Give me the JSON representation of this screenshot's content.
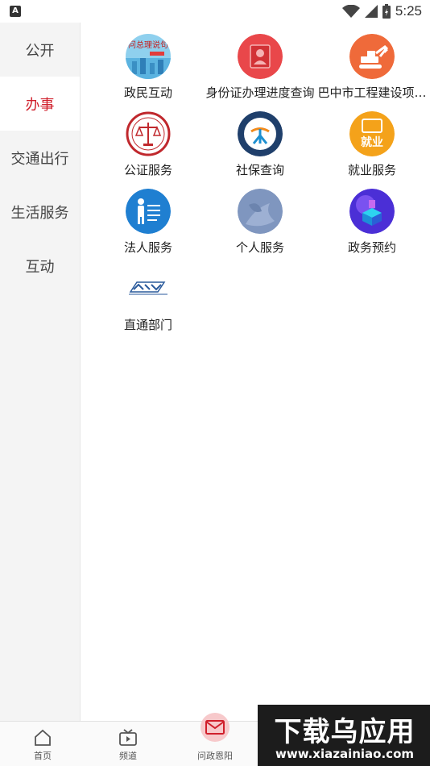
{
  "status_bar": {
    "notification_badge": "A",
    "time": "5:25",
    "icons": [
      "wifi-icon",
      "cellular-icon",
      "battery-icon"
    ]
  },
  "sidebar": {
    "items": [
      {
        "label": "公开",
        "active": false
      },
      {
        "label": "办事",
        "active": true
      },
      {
        "label": "交通出行",
        "active": false
      },
      {
        "label": "生活服务",
        "active": false
      },
      {
        "label": "互动",
        "active": false
      }
    ]
  },
  "services": [
    {
      "label": "政民互动",
      "icon": "poster-icon"
    },
    {
      "label": "身份证办理进度查询",
      "icon": "id-card-icon"
    },
    {
      "label": "巴中市工程建设项…",
      "icon": "excavator-icon"
    },
    {
      "label": "公证服务",
      "icon": "scales-icon"
    },
    {
      "label": "社保查询",
      "icon": "social-security-icon"
    },
    {
      "label": "就业服务",
      "icon": "employment-icon"
    },
    {
      "label": "法人服务",
      "icon": "corporate-icon"
    },
    {
      "label": "个人服务",
      "icon": "person-icon"
    },
    {
      "label": "政务预约",
      "icon": "appointment-icon"
    },
    {
      "label": "直通部门",
      "icon": "direct-department-icon"
    }
  ],
  "service_icon_texts": {
    "poster_title": "问总理说句",
    "employment": "就业"
  },
  "bottom_nav": {
    "items": [
      {
        "label": "首页",
        "icon": "home-icon"
      },
      {
        "label": "频道",
        "icon": "tv-icon"
      },
      {
        "label": "问政恩阳",
        "icon": "mail-icon"
      }
    ]
  },
  "watermark": {
    "title": "下载乌应用",
    "url": "www.xiazainiao.com"
  },
  "colors": {
    "accent": "#d01f2b",
    "sidebar_bg": "#f4f4f4",
    "badge_bg": "#f7c9cb"
  }
}
